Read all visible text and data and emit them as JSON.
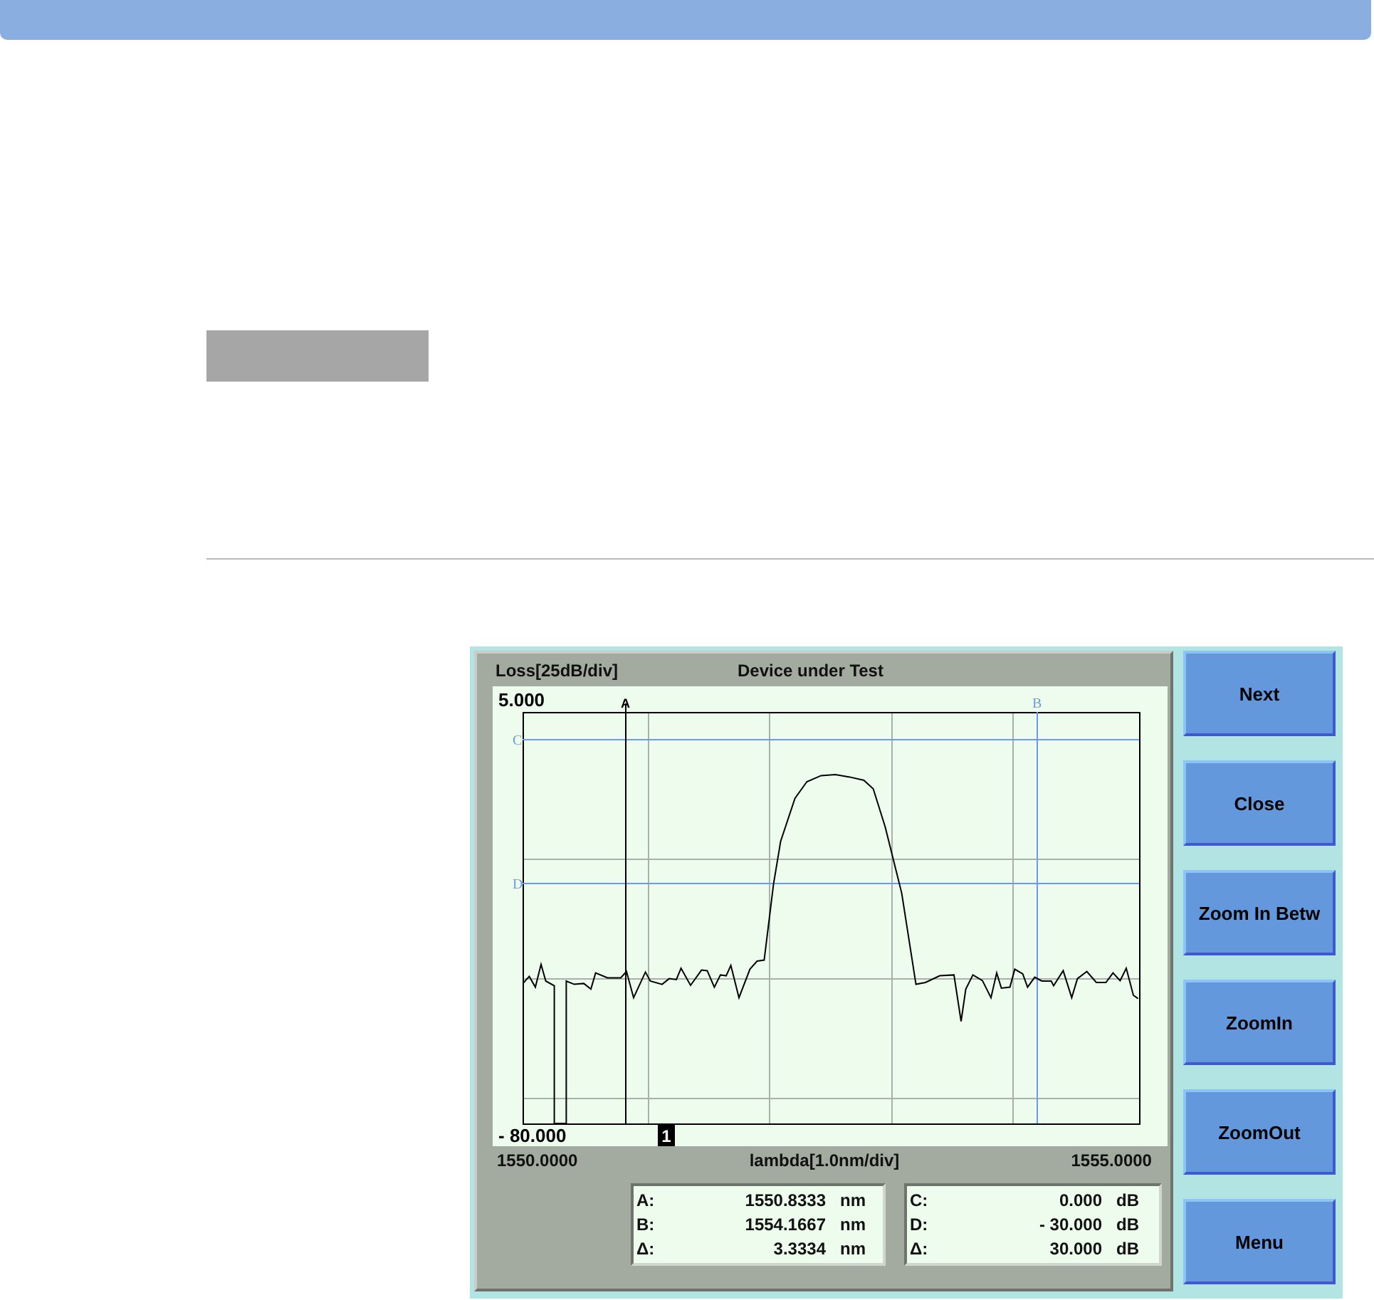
{
  "instrument": {
    "y_axis_label": "Loss[25dB/div]",
    "title": "Device under Test",
    "y_max": "5.000",
    "y_min": "- 80.000",
    "trace_marker": "1",
    "cursor_labels": {
      "a": "A",
      "b": "B",
      "c": "C",
      "d": "D"
    },
    "x_min": "1550.0000",
    "x_axis_label": "lambda[1.0nm/div]",
    "x_max": "1555.0000",
    "wavelength_readout": [
      {
        "label": "A:",
        "value": "1550.8333",
        "unit": "nm"
      },
      {
        "label": "B:",
        "value": "1554.1667",
        "unit": "nm"
      },
      {
        "label": "Δ:",
        "value": "3.3334",
        "unit": "nm"
      }
    ],
    "loss_readout": [
      {
        "label": "C:",
        "value": "0.000",
        "unit": "dB"
      },
      {
        "label": "D:",
        "value": "- 30.000",
        "unit": "dB"
      },
      {
        "label": "Δ:",
        "value": "30.000",
        "unit": "dB"
      }
    ]
  },
  "buttons": [
    "Next",
    "Close",
    "Zoom In Betw",
    "ZoomIn",
    "ZoomOut",
    "Menu"
  ]
}
